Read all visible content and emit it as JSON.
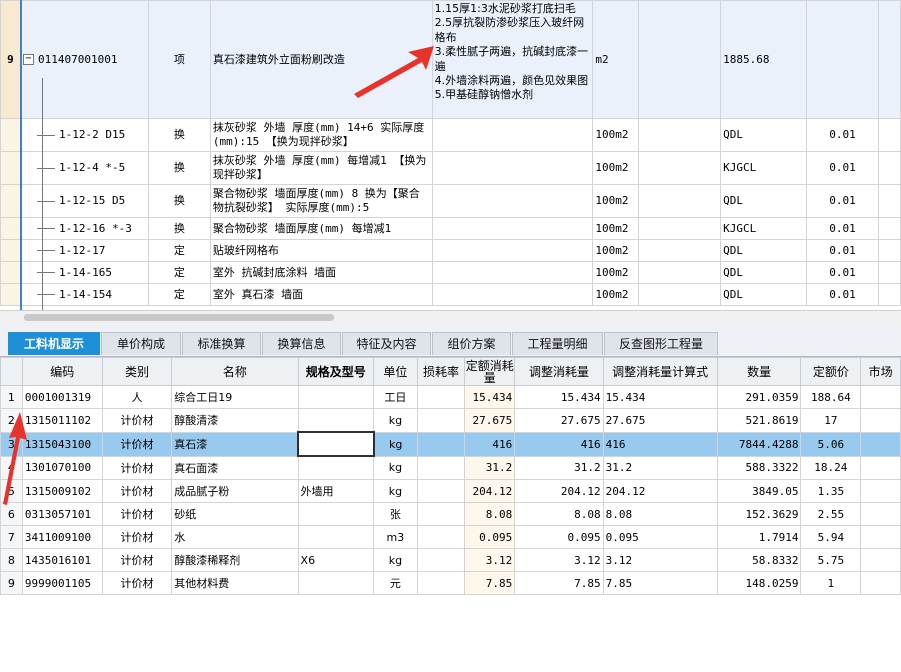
{
  "top_grid": {
    "main_row": {
      "index": "9",
      "code": "011407001001",
      "category": "项",
      "name": "真石漆建筑外立面粉刷改造",
      "features": [
        "1.15厚1:3水泥砂浆打底扫毛",
        "2.5厚抗裂防渗砂浆压入玻纤网格布",
        "3.柔性腻子两遍，抗碱封底漆一遍",
        "4.外墙涂料两遍，颜色见效果图",
        "5.甲基硅醇钠憎水剂"
      ],
      "unit": "m2",
      "qty_expr": "1885.68"
    },
    "sub_rows": [
      {
        "code": "1-12-2 D15",
        "category": "换",
        "name": "抹灰砂浆 外墙 厚度(mm) 14+6  实际厚度(mm):15 【换为现拌砂浆】",
        "unit": "100m2",
        "qty_expr": "QDL",
        "qty": "0.01"
      },
      {
        "code": "1-12-4 *-5",
        "category": "换",
        "name": "抹灰砂浆 外墙 厚度(mm) 每增减1 【换为现拌砂浆】",
        "unit": "100m2",
        "qty_expr": "KJGCL",
        "qty": "0.01"
      },
      {
        "code": "1-12-15 D5",
        "category": "换",
        "name": "聚合物砂浆 墙面厚度(mm) 8  换为【聚合物抗裂砂浆】 实际厚度(mm):5",
        "unit": "100m2",
        "qty_expr": "QDL",
        "qty": "0.01"
      },
      {
        "code": "1-12-16 *-3",
        "category": "换",
        "name": "聚合物砂浆 墙面厚度(mm) 每增减1",
        "unit": "100m2",
        "qty_expr": "KJGCL",
        "qty": "0.01"
      },
      {
        "code": "1-12-17",
        "category": "定",
        "name": "贴玻纤网格布",
        "unit": "100m2",
        "qty_expr": "QDL",
        "qty": "0.01"
      },
      {
        "code": "1-14-165",
        "category": "定",
        "name": "室外 抗碱封底涂料 墙面",
        "unit": "100m2",
        "qty_expr": "QDL",
        "qty": "0.01"
      },
      {
        "code": "1-14-154",
        "category": "定",
        "name": "室外 真石漆 墙面",
        "unit": "100m2",
        "qty_expr": "QDL",
        "qty": "0.01"
      }
    ]
  },
  "tabs": [
    "工料机显示",
    "单价构成",
    "标准换算",
    "换算信息",
    "特征及内容",
    "组价方案",
    "工程量明细",
    "反查图形工程量"
  ],
  "bottom_grid": {
    "headers": [
      "编码",
      "类别",
      "名称",
      "规格及型号",
      "单位",
      "损耗率",
      "定额消耗量",
      "调整消耗量",
      "调整消耗量计算式",
      "数量",
      "定额价",
      "市场"
    ],
    "rows": [
      {
        "n": "1",
        "code": "0001001319",
        "type": "人",
        "name": "综合工日19",
        "spec": "",
        "unit": "工日",
        "loss": "",
        "quota": "15.434",
        "adj": "15.434",
        "adj_expr": "15.434",
        "qty": "291.0359",
        "price": "188.64"
      },
      {
        "n": "2",
        "code": "1315011102",
        "type": "计价材",
        "name": "醇酸清漆",
        "spec": "",
        "unit": "kg",
        "loss": "",
        "quota": "27.675",
        "adj": "27.675",
        "adj_expr": "27.675",
        "qty": "521.8619",
        "price": "17"
      },
      {
        "n": "3",
        "code": "1315043100",
        "type": "计价材",
        "name": "真石漆",
        "spec": "",
        "unit": "kg",
        "loss": "",
        "quota": "416",
        "adj": "416",
        "adj_expr": "416",
        "qty": "7844.4288",
        "price": "5.06"
      },
      {
        "n": "4",
        "code": "1301070100",
        "type": "计价材",
        "name": "真石面漆",
        "spec": "",
        "unit": "kg",
        "loss": "",
        "quota": "31.2",
        "adj": "31.2",
        "adj_expr": "31.2",
        "qty": "588.3322",
        "price": "18.24"
      },
      {
        "n": "5",
        "code": "1315009102",
        "type": "计价材",
        "name": "成品腻子粉",
        "spec": "外墙用",
        "unit": "kg",
        "loss": "",
        "quota": "204.12",
        "adj": "204.12",
        "adj_expr": "204.12",
        "qty": "3849.05",
        "price": "1.35"
      },
      {
        "n": "6",
        "code": "0313057101",
        "type": "计价材",
        "name": "砂纸",
        "spec": "",
        "unit": "张",
        "loss": "",
        "quota": "8.08",
        "adj": "8.08",
        "adj_expr": "8.08",
        "qty": "152.3629",
        "price": "2.55"
      },
      {
        "n": "7",
        "code": "3411009100",
        "type": "计价材",
        "name": "水",
        "spec": "",
        "unit": "m3",
        "loss": "",
        "quota": "0.095",
        "adj": "0.095",
        "adj_expr": "0.095",
        "qty": "1.7914",
        "price": "5.94"
      },
      {
        "n": "8",
        "code": "1435016101",
        "type": "计价材",
        "name": "醇酸漆稀释剂",
        "spec": "X6",
        "unit": "kg",
        "loss": "",
        "quota": "3.12",
        "adj": "3.12",
        "adj_expr": "3.12",
        "qty": "58.8332",
        "price": "5.75"
      },
      {
        "n": "9",
        "code": "9999001105",
        "type": "计价材",
        "name": "其他材料费",
        "spec": "",
        "unit": "元",
        "loss": "",
        "quota": "7.85",
        "adj": "7.85",
        "adj_expr": "7.85",
        "qty": "148.0259",
        "price": "1"
      }
    ],
    "selected_row": 2
  },
  "colors": {
    "tab_active": "#1f8fd8",
    "selected_row": "#98c9ef",
    "annotation_arrow": "#e8332c"
  }
}
